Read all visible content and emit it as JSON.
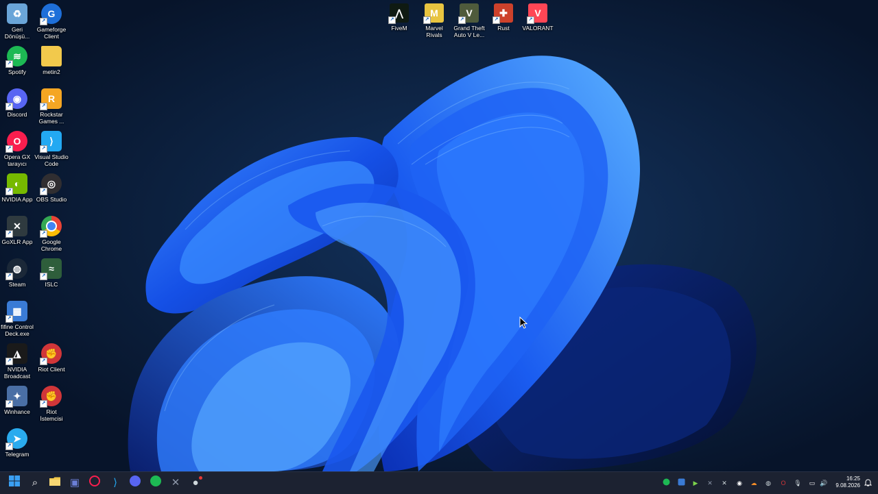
{
  "desktop": {
    "left_icons": [
      {
        "label": "Geri Dönüşü...",
        "icon": "recycle-bin-icon",
        "color": "#6aa5d8"
      },
      {
        "label": "Gameforge Client",
        "icon": "gameforge-icon",
        "color": "#1e6fd9"
      },
      {
        "label": "Spotify",
        "icon": "spotify-icon",
        "color": "#1db954"
      },
      {
        "label": "metin2",
        "icon": "folder-icon",
        "color": "#f2c94c"
      },
      {
        "label": "Discord",
        "icon": "discord-icon",
        "color": "#5865f2"
      },
      {
        "label": "Rockstar Games ...",
        "icon": "rockstar-icon",
        "color": "#f5a623"
      },
      {
        "label": "Opera GX tarayıcı",
        "icon": "opera-gx-icon",
        "color": "#fa1e4e"
      },
      {
        "label": "Visual Studio Code",
        "icon": "vscode-icon",
        "color": "#23a9f2"
      },
      {
        "label": "NVIDIA App",
        "icon": "nvidia-icon",
        "color": "#76b900"
      },
      {
        "label": "OBS Studio",
        "icon": "obs-icon",
        "color": "#302e31"
      },
      {
        "label": "GoXLR App",
        "icon": "goxlr-icon",
        "color": "#2f3a3f"
      },
      {
        "label": "Google Chrome",
        "icon": "chrome-icon",
        "color": "#ea4335"
      },
      {
        "label": "Steam",
        "icon": "steam-icon",
        "color": "#1b2838"
      },
      {
        "label": "ISLC",
        "icon": "islc-icon",
        "color": "#2e5e3b"
      },
      {
        "label": "fifine Control Deck.exe",
        "icon": "fifine-icon",
        "color": "#3a7bd5"
      },
      {
        "label": "NVIDIA Broadcast",
        "icon": "nvidia-broadcast-icon",
        "color": "#1a1a1a"
      },
      {
        "label": "Riot Client",
        "icon": "riot-client-icon",
        "color": "#d13639"
      },
      {
        "label": "Winhance",
        "icon": "winhance-icon",
        "color": "#4a6fa5"
      },
      {
        "label": "Riot İstemcisi",
        "icon": "riot-istemcisi-icon",
        "color": "#d13639"
      },
      {
        "label": "Telegram",
        "icon": "telegram-icon",
        "color": "#2aabee"
      }
    ],
    "top_icons": [
      {
        "label": "FiveM",
        "icon": "fivem-icon",
        "color": "#0f1a12"
      },
      {
        "label": "Marvel Rivals",
        "icon": "marvel-rivals-icon",
        "color": "#e8c440"
      },
      {
        "label": "Grand Theft Auto V Le...",
        "icon": "gta-v-icon",
        "color": "#4f5b3c"
      },
      {
        "label": "Rust",
        "icon": "rust-icon",
        "color": "#cd412b"
      },
      {
        "label": "VALORANT",
        "icon": "valorant-icon",
        "color": "#ff4655"
      }
    ]
  },
  "taskbar": {
    "pinned": [
      {
        "name": "start-button",
        "icon": "windows-logo-icon",
        "color": "#3aa0f3"
      },
      {
        "name": "search-button",
        "icon": "search-icon",
        "color": "#ffffff"
      },
      {
        "name": "file-explorer-button",
        "icon": "folder-icon",
        "color": "#f2c94c"
      },
      {
        "name": "app-button",
        "icon": "app-icon",
        "color": "#6b7fd7"
      },
      {
        "name": "opera-gx-button",
        "icon": "opera-gx-icon",
        "color": "#fa1e4e"
      },
      {
        "name": "vscode-button",
        "icon": "vscode-icon",
        "color": "#23a9f2"
      },
      {
        "name": "discord-button",
        "icon": "discord-icon",
        "color": "#5865f2"
      },
      {
        "name": "spotify-button",
        "icon": "spotify-icon",
        "color": "#1db954"
      },
      {
        "name": "goxlr-button",
        "icon": "goxlr-icon",
        "color": "#8c96a8"
      },
      {
        "name": "chrome-button",
        "icon": "chrome-icon",
        "color": "#cfd8dc"
      }
    ],
    "tray": [
      {
        "name": "tray-spotify",
        "icon": "spotify-icon",
        "color": "#1db954"
      },
      {
        "name": "tray-app",
        "icon": "app-icon",
        "color": "#3a7bd5"
      },
      {
        "name": "tray-play",
        "icon": "play-icon",
        "color": "#7cd34c"
      },
      {
        "name": "tray-goxlr",
        "icon": "goxlr-icon",
        "color": "#8c96a8"
      },
      {
        "name": "tray-x",
        "icon": "x-icon",
        "color": "#cfd8dc"
      },
      {
        "name": "tray-discord",
        "icon": "discord-icon",
        "color": "#ffffff"
      },
      {
        "name": "tray-cloud",
        "icon": "cloud-icon",
        "color": "#f28c28"
      },
      {
        "name": "tray-steam",
        "icon": "steam-icon",
        "color": "#cfd8dc"
      },
      {
        "name": "tray-riot",
        "icon": "riot-icon",
        "color": "#d13639"
      },
      {
        "name": "tray-mic",
        "icon": "microphone-icon",
        "color": "#cfd8dc"
      },
      {
        "name": "tray-network",
        "icon": "network-icon",
        "color": "#ffffff"
      },
      {
        "name": "tray-volume",
        "icon": "volume-icon",
        "color": "#ffffff"
      }
    ],
    "clock": {
      "time": "16:25",
      "date": "9.08.2026"
    }
  }
}
